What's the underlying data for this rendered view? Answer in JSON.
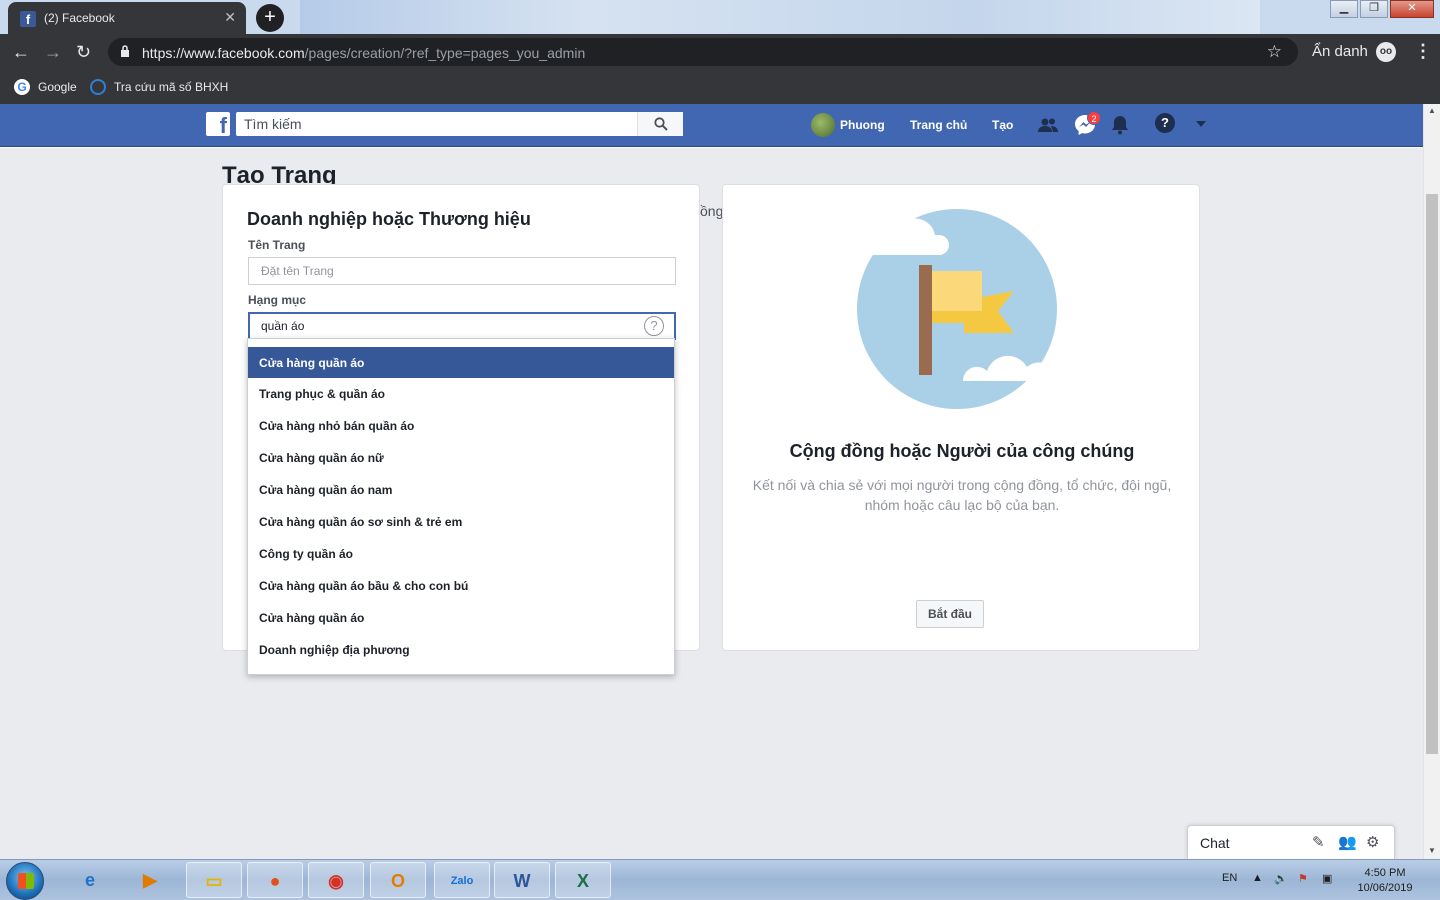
{
  "browser": {
    "tab_title": "(2) Facebook",
    "tab_favicon": "f",
    "url_host": "https://www.facebook.com",
    "url_path": "/pages/creation/?ref_type=pages_you_admin",
    "incognito_label": "Ẩn danh",
    "bookmarks": [
      {
        "label": "Google",
        "icon": "google-icon"
      },
      {
        "label": "Tra cứu mã số BHXH",
        "icon": "bhxh-icon"
      }
    ]
  },
  "fb_header": {
    "logo": "f",
    "search_placeholder": "Tìm kiếm",
    "user_name": "Phuong",
    "home_label": "Trang chủ",
    "create_label": "Tạo",
    "messenger_badge": "2",
    "help_glyph": "?"
  },
  "page": {
    "title": "Tạo Trang",
    "hidden_fragment": "ồng"
  },
  "business_card": {
    "title": "Doanh nghiệp hoặc Thương hiệu",
    "name_label": "Tên Trang",
    "name_placeholder": "Đặt tên Trang",
    "category_label": "Hạng mục",
    "category_value": "quần áo",
    "help_glyph": "?"
  },
  "category_suggestions": [
    "Cửa hàng quần áo",
    "Trang phục & quần áo",
    "Cửa hàng nhỏ bán quần áo",
    "Cửa hàng quần áo nữ",
    "Cửa hàng quần áo nam",
    "Cửa hàng quần áo sơ sinh & trẻ em",
    "Công ty quần áo",
    "Cửa hàng quần áo bầu & cho con bú",
    "Cửa hàng quần áo",
    "Doanh nghiệp địa phương"
  ],
  "selected_suggestion_index": 0,
  "community_card": {
    "title": "Cộng đồng hoặc Người của công chúng",
    "description_line1": "Kết nối và chia sẻ với mọi người trong cộng đồng, tổ chức, đội ngũ,",
    "description_line2": "nhóm hoặc câu lạc bộ của bạn.",
    "start_button": "Bắt đầu"
  },
  "chat": {
    "label": "Chat"
  },
  "taskbar": {
    "apps": [
      "start",
      "internet-explorer",
      "media-player",
      "file-explorer",
      "firefox",
      "chrome",
      "outlook",
      "zalo",
      "word",
      "excel"
    ],
    "zalo_label": "Zalo",
    "language": "EN",
    "time": "4:50 PM",
    "date": "10/06/2019"
  },
  "colors": {
    "fb_blue": "#4267b2",
    "selected_option": "#365899",
    "page_bg": "#e9ebee",
    "chrome_dark": "#35363a"
  }
}
